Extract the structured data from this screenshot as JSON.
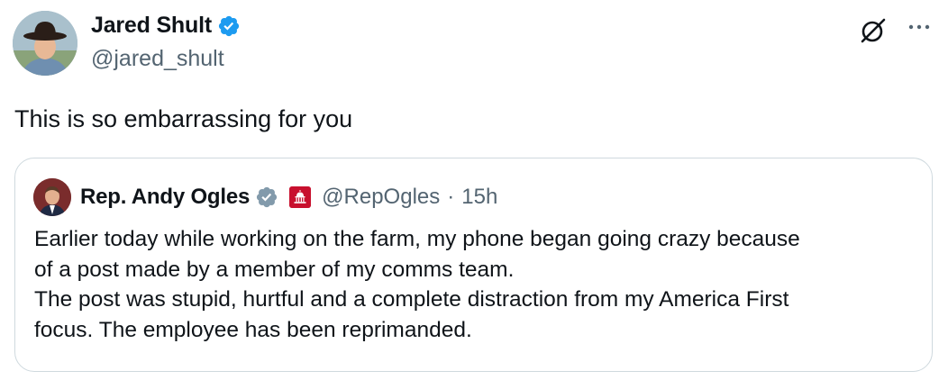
{
  "author": {
    "display_name": "Jared Shult",
    "handle": "@jared_shult",
    "verified": true
  },
  "tweet": {
    "text": "This is so embarrassing for you"
  },
  "quoted_tweet": {
    "display_name": "Rep. Andy Ogles",
    "handle": "@RepOgles",
    "separator": "·",
    "time": "15h",
    "verified": "gray",
    "affiliation_badge": "government-capitol-icon",
    "lines": [
      "Earlier today while working on the farm, my phone began going crazy because",
      "of a post made by a member of my comms team.",
      "The post was stupid, hurtful and a complete distraction from my America First",
      "focus. The employee has been reprimanded."
    ]
  },
  "icons": {
    "verified_color": "#1d9bf0",
    "gray_verified_color": "#829aab",
    "affiliation_color": "#c8102e"
  }
}
